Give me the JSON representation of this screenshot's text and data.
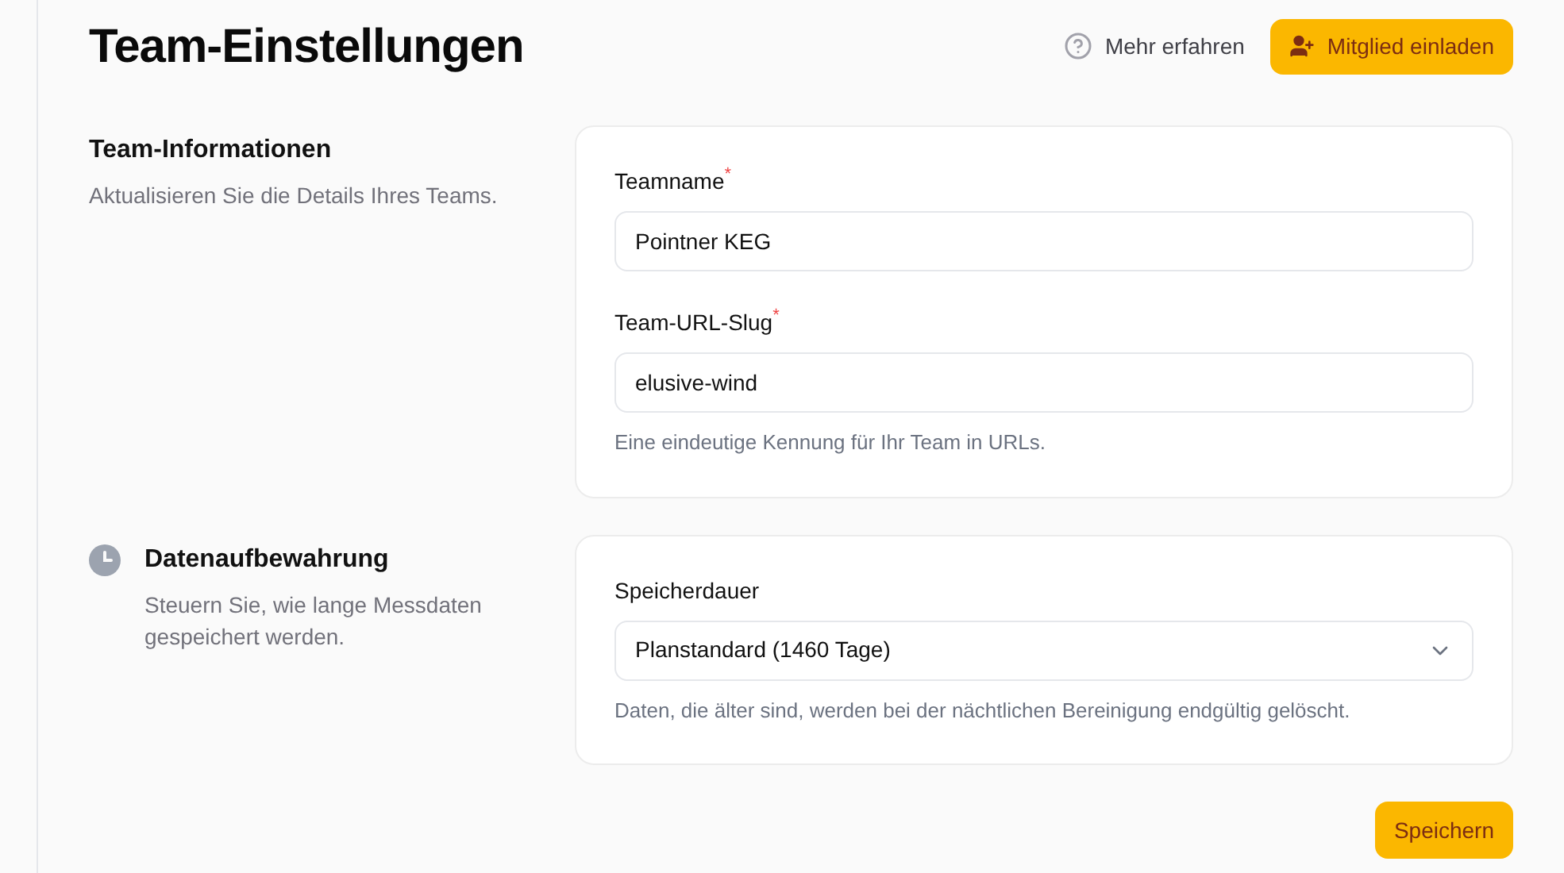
{
  "header": {
    "title": "Team-Einstellungen",
    "help_link": "Mehr erfahren",
    "invite_button": "Mitglied einladen"
  },
  "sections": [
    {
      "title": "Team-Informationen",
      "description": "Aktualisieren Sie die Details Ihres Teams.",
      "kind": "general",
      "fields": [
        {
          "kind": "text",
          "label": "Teamname",
          "required_mark": "*",
          "value": "Pointner KEG"
        },
        {
          "kind": "text",
          "label": "Team-URL-Slug",
          "required_mark": "*",
          "value": "elusive-wind",
          "hint": "Eine eindeutige Kennung für Ihr Team in URLs."
        }
      ]
    },
    {
      "title": "Datenaufbewahrung",
      "description": "Steuern Sie, wie lange Messdaten gespeichert werden.",
      "kind": "retention",
      "fields": [
        {
          "kind": "select",
          "label": "Speicherdauer",
          "value": "Planstandard (1460 Tage)",
          "hint": "Daten, die älter sind, werden bei der nächtlichen Bereinigung endgültig gelöscht."
        }
      ]
    }
  ],
  "save_button": "Speichern"
}
